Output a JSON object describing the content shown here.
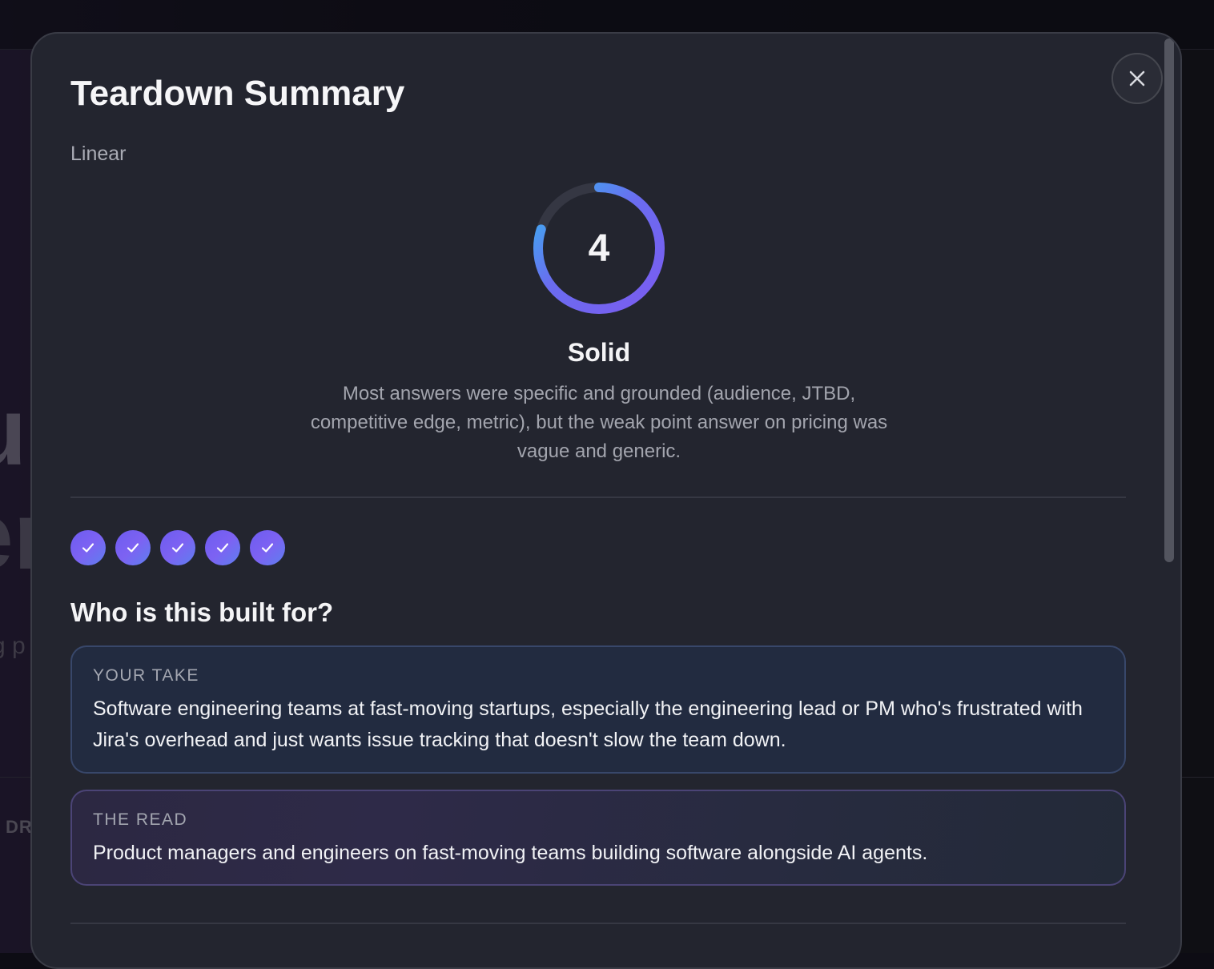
{
  "background": {
    "hero_line_1": "u",
    "hero_line_2": "er",
    "hero_sub": "g p",
    "section_label": "DR"
  },
  "modal": {
    "title": "Teardown Summary",
    "subtitle": "Linear",
    "close_icon": "close-icon",
    "score": {
      "value": "4",
      "max": 5,
      "fraction": 0.8,
      "label": "Solid",
      "description": "Most answers were specific and grounded (audience, JTBD, competitive edge, metric), but the weak point answer on pricing was vague and generic.",
      "ring_gradient": [
        "#7b5cf0",
        "#36b8f0"
      ],
      "track_color": "#353743"
    },
    "progress_checks": [
      {
        "icon": "check-icon",
        "done": true
      },
      {
        "icon": "check-icon",
        "done": true
      },
      {
        "icon": "check-icon",
        "done": true
      },
      {
        "icon": "check-icon",
        "done": true
      },
      {
        "icon": "check-icon",
        "done": true
      }
    ],
    "section": {
      "title": "Who is this built for?",
      "your_take": {
        "label": "YOUR TAKE",
        "text": "Software engineering teams at fast-moving startups, especially the engineering lead or PM who's frustrated with Jira's overhead and just wants issue tracking that doesn't slow the team down."
      },
      "the_read": {
        "label": "THE READ",
        "text": "Product managers and engineers on fast-moving teams building software alongside AI agents."
      }
    },
    "accent_color": "#7061f0"
  }
}
